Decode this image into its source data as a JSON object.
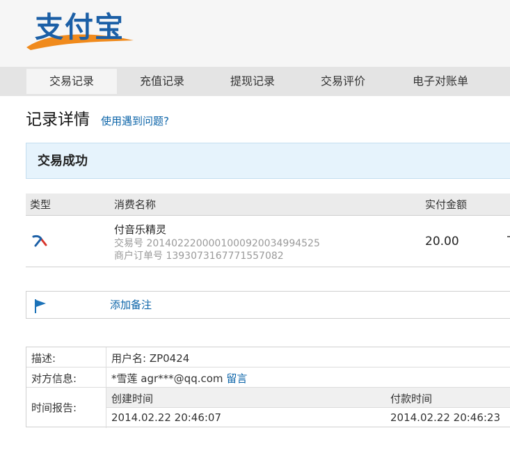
{
  "brand": {
    "logo_text": "支付宝",
    "colors": {
      "blue": "#1b5fa6",
      "orange": "#f08a1c"
    }
  },
  "nav": {
    "tabs": [
      {
        "label": "交易记录",
        "active": true
      },
      {
        "label": "充值记录",
        "active": false
      },
      {
        "label": "提现记录",
        "active": false
      },
      {
        "label": "交易评价",
        "active": false
      },
      {
        "label": "电子对账单",
        "active": false
      }
    ]
  },
  "page": {
    "title": "记录详情",
    "help_link": "使用遇到问题?"
  },
  "status": {
    "text": "交易成功"
  },
  "transaction": {
    "headers": {
      "type": "类型",
      "name": "消费名称",
      "amount": "实付金额"
    },
    "row": {
      "type_icon": "arrow-icon",
      "name": "付音乐精灵",
      "trade_no": "交易号 2014022200001000920034994525",
      "order_no": "商户订单号 1393073167771557082",
      "amount": "20.00"
    }
  },
  "note": {
    "icon": "flag-icon",
    "link": "添加备注"
  },
  "info": {
    "description": {
      "label": "描述:",
      "value": "用户名: ZP0424"
    },
    "counterparty": {
      "label": "对方信息:",
      "name": "*雪莲",
      "email": "agr***@qq.com",
      "message_link": "留言"
    },
    "time": {
      "label": "时间报告:",
      "created_label": "创建时间",
      "paid_label": "付款时间",
      "created_value": "2014.02.22 20:46:07",
      "paid_value": "2014.02.22 20:46:23"
    }
  },
  "accent_colors": {
    "link": "#0a63a8",
    "status_bg": "#e6f3fc"
  }
}
